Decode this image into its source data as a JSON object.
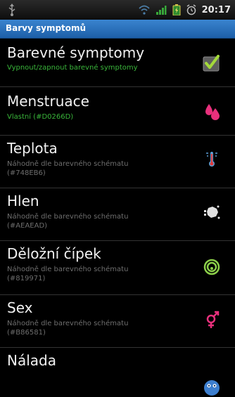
{
  "status": {
    "time": "20:17"
  },
  "title": "Barvy symptomů",
  "rows": [
    {
      "title": "Barevné symptomy",
      "sub1": "Vypnout/zapnout barevné symptomy",
      "sub2": "",
      "icon": "checkbox-checked-icon"
    },
    {
      "title": "Menstruace",
      "sub1": "Vlastní (#D0266D)",
      "sub2": "",
      "icon": "drops-icon",
      "color": "#D0266D"
    },
    {
      "title": "Teplota",
      "sub1": "Náhodně dle barevného schématu",
      "sub2": "(#748EB6)",
      "icon": "thermometer-icon",
      "color": "#748EB6"
    },
    {
      "title": "Hlen",
      "sub1": "Náhodně dle barevného schématu",
      "sub2": "(#AEAEAD)",
      "icon": "mucus-icon",
      "color": "#AEAEAD"
    },
    {
      "title": "Děložní čípek",
      "sub1": "Náhodně dle barevného schématu",
      "sub2": "(#819971)",
      "icon": "cervix-icon",
      "color": "#819971"
    },
    {
      "title": "Sex",
      "sub1": "Náhodně dle barevného schématu",
      "sub2": "(#B86581)",
      "icon": "sex-symbol-icon",
      "color": "#B86581"
    },
    {
      "title": "Nálada",
      "sub1": "",
      "sub2": "",
      "icon": "mood-icon"
    }
  ]
}
